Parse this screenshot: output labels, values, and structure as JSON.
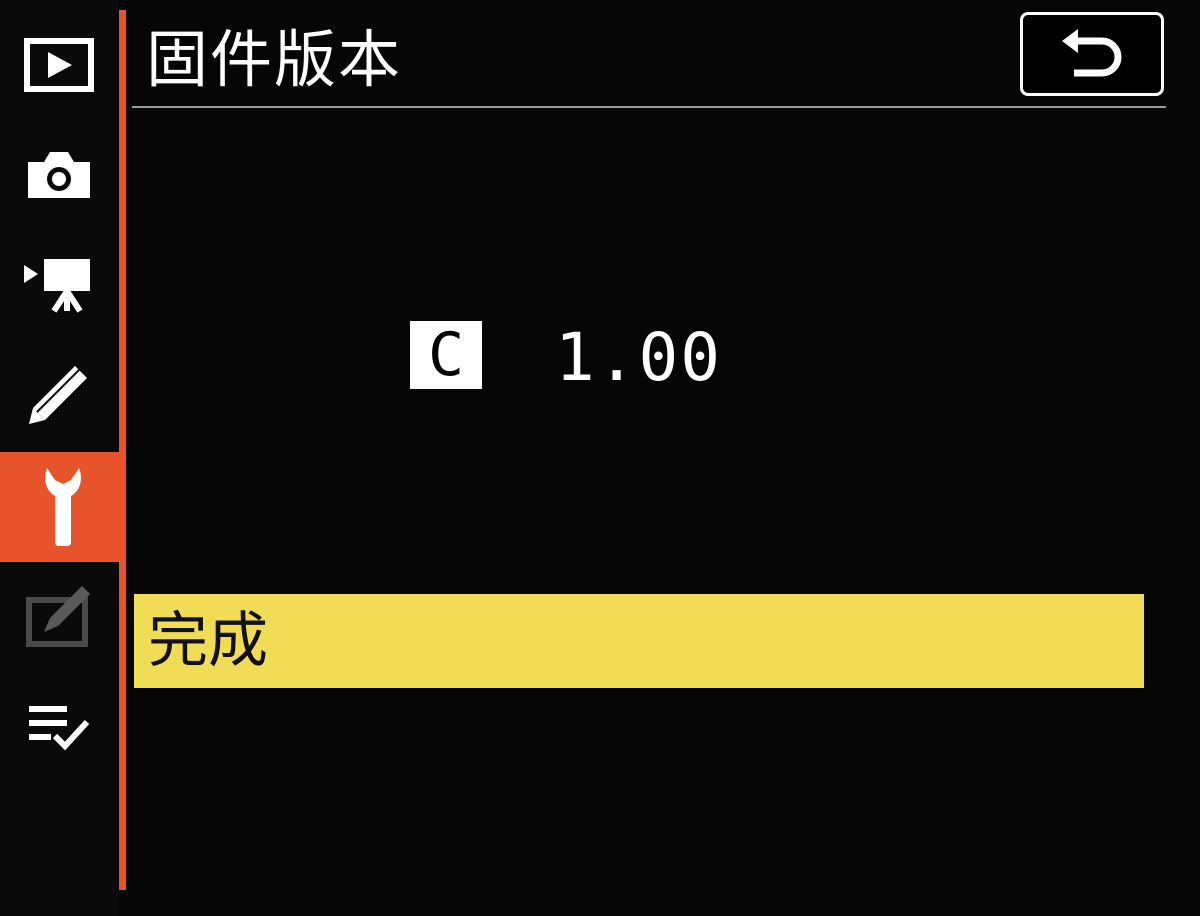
{
  "header": {
    "title": "固件版本",
    "back_icon": "return-arrow-icon"
  },
  "sidebar": {
    "items": [
      {
        "name": "playback",
        "icon": "playback-icon",
        "active": false
      },
      {
        "name": "photo-shooting",
        "icon": "camera-icon",
        "active": false
      },
      {
        "name": "movie-recording",
        "icon": "movie-camera-icon",
        "active": false
      },
      {
        "name": "custom-settings",
        "icon": "pencil-icon",
        "active": false
      },
      {
        "name": "setup",
        "icon": "wrench-icon",
        "active": true
      },
      {
        "name": "retouch",
        "icon": "retouch-icon",
        "active": false,
        "dimmed": true
      },
      {
        "name": "my-menu",
        "icon": "checklist-icon",
        "active": false
      }
    ]
  },
  "firmware": {
    "badge": "C",
    "version": "1.00"
  },
  "action": {
    "done_label": "完成"
  },
  "colors": {
    "accent": "#e8542a",
    "highlight": "#f1dd55",
    "background": "#060606"
  }
}
